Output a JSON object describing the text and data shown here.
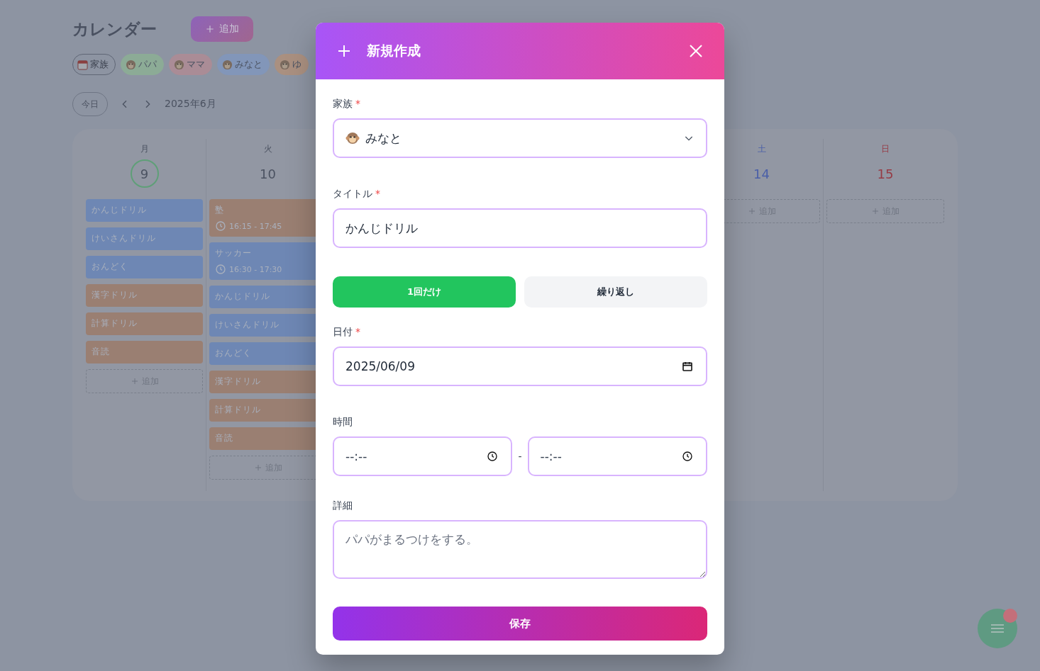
{
  "page": {
    "title": "カレンダー",
    "add_button": "追加"
  },
  "filters": [
    {
      "kind": "all",
      "label": "家族"
    },
    {
      "kind": "member",
      "label": "パパ",
      "color": "#8cab96"
    },
    {
      "kind": "member",
      "label": "ママ",
      "color": "#aa8c96"
    },
    {
      "kind": "member",
      "label": "みなと",
      "color": "#8296b9"
    },
    {
      "kind": "member",
      "label": "ゆ",
      "color": "#aa9080"
    }
  ],
  "nav": {
    "today": "今日",
    "month": "2025年6月"
  },
  "days": [
    {
      "weekday": "月",
      "date": "9",
      "kind": "weekday",
      "today": true,
      "add": "追加",
      "events": [
        {
          "title": "かんじドリル",
          "color": "#6e87b4"
        },
        {
          "title": "けいさんドリル",
          "color": "#6e87b4"
        },
        {
          "title": "おんどく",
          "color": "#6e87b4"
        },
        {
          "title": "漢字ドリル",
          "color": "#9a7f72"
        },
        {
          "title": "計算ドリル",
          "color": "#9a7f72"
        },
        {
          "title": "音読",
          "color": "#9a7f72"
        }
      ]
    },
    {
      "weekday": "火",
      "date": "10",
      "kind": "weekday",
      "today": false,
      "add": "追加",
      "events": [
        {
          "title": "塾",
          "time": "16:15 - 17:45",
          "color": "#9a7f72"
        },
        {
          "title": "サッカー",
          "time": "16:30 - 17:30",
          "color": "#6e87b4"
        },
        {
          "title": "かんじドリル",
          "color": "#6e87b4"
        },
        {
          "title": "けいさんドリル",
          "color": "#6e87b4"
        },
        {
          "title": "おんどく",
          "color": "#6e87b4"
        },
        {
          "title": "漢字ドリル",
          "color": "#9a7f72"
        },
        {
          "title": "計算ドリル",
          "color": "#9a7f72"
        },
        {
          "title": "音読",
          "color": "#9a7f72"
        }
      ]
    },
    {
      "weekday": "土",
      "date": "14",
      "kind": "saturday",
      "today": false,
      "add": "追加"
    },
    {
      "weekday": "日",
      "date": "15",
      "kind": "sunday",
      "today": false,
      "add": "追加"
    }
  ],
  "modal": {
    "title": "新規作成",
    "family": {
      "label": "家族",
      "required_mark": "*",
      "value": "みなと"
    },
    "title_field": {
      "label": "タイトル",
      "required_mark": "*",
      "value": "かんじドリル"
    },
    "modes": [
      {
        "label": "1回だけ",
        "selected": true
      },
      {
        "label": "繰り返し",
        "selected": false
      }
    ],
    "date": {
      "label": "日付",
      "required_mark": "*",
      "value": "2025/06/09"
    },
    "time": {
      "label": "時間",
      "start_placeholder": "--:--",
      "separator": "-",
      "end_placeholder": "--:--"
    },
    "detail": {
      "label": "詳細",
      "placeholder": "パパがまるつけをする。"
    },
    "save": "保存"
  }
}
